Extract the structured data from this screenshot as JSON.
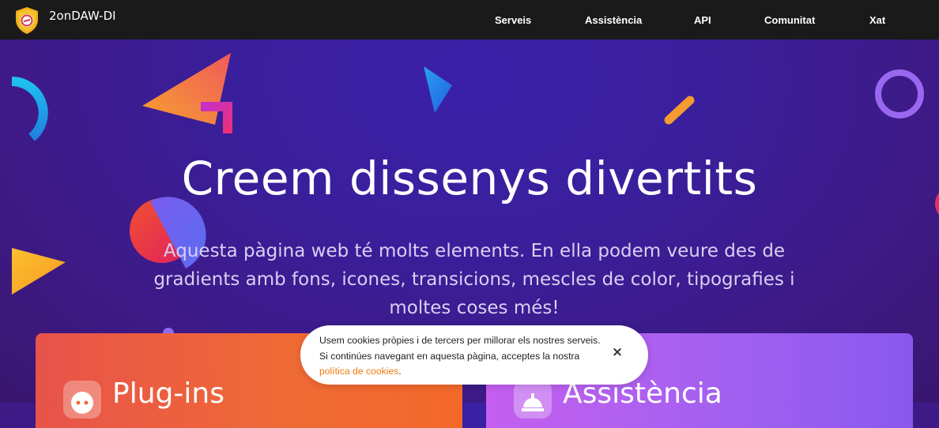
{
  "header": {
    "brand": "2onDAW-DI",
    "nav": [
      {
        "label": "Serveis"
      },
      {
        "label": "Assistència"
      },
      {
        "label": "API"
      },
      {
        "label": "Comunitat"
      },
      {
        "label": "Xat"
      }
    ]
  },
  "hero": {
    "title": "Creem dissenys divertits",
    "text": "Aquesta pàgina web té molts elements. En ella podem veure des de gradients amb fons, icones, transicions, mescles de color, tipografies i moltes coses més!"
  },
  "cards": [
    {
      "title": "Plug-ins",
      "icon": "plug-icon"
    },
    {
      "title": "Assistència",
      "icon": "bell-icon"
    }
  ],
  "cookie": {
    "text": "Usem cookies pròpies i de tercers per millorar els nostres serveis. Si continúes navegant en aquesta pàgina, acceptes la nostra ",
    "link": "política de cookies",
    "suffix": ".",
    "close": "×"
  },
  "colors": {
    "topbar": "#1a1a1a",
    "accent_orange": "#f07a10",
    "hero_bg": "#3a1f9c"
  }
}
